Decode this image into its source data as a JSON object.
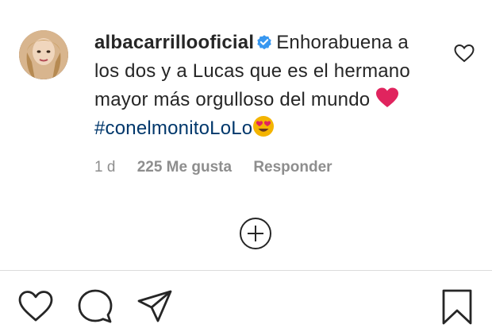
{
  "comment": {
    "username": "albacarrillooficial",
    "text_before_hashtag": "Enhorabuena a los dos y a Lucas que es el hermano mayor más orgulloso del mundo",
    "hashtag": "#conelmonitoLoLo",
    "time": "1 d",
    "likes": "225 Me gusta",
    "reply_label": "Responder"
  },
  "icons": {
    "avatar": "avatar",
    "verified": "verified-badge-icon",
    "like_comment": "heart-outline-icon",
    "load_more": "plus-circle-icon",
    "like_post": "heart-outline-icon",
    "comment_post": "speech-bubble-icon",
    "share_post": "paper-plane-icon",
    "save_post": "bookmark-icon"
  },
  "colors": {
    "text": "#262626",
    "muted": "#8e8e8e",
    "hashtag": "#00376b",
    "verified": "#3897f0",
    "heart_emoji": "#e0245e",
    "divider": "#dbdbdb"
  }
}
